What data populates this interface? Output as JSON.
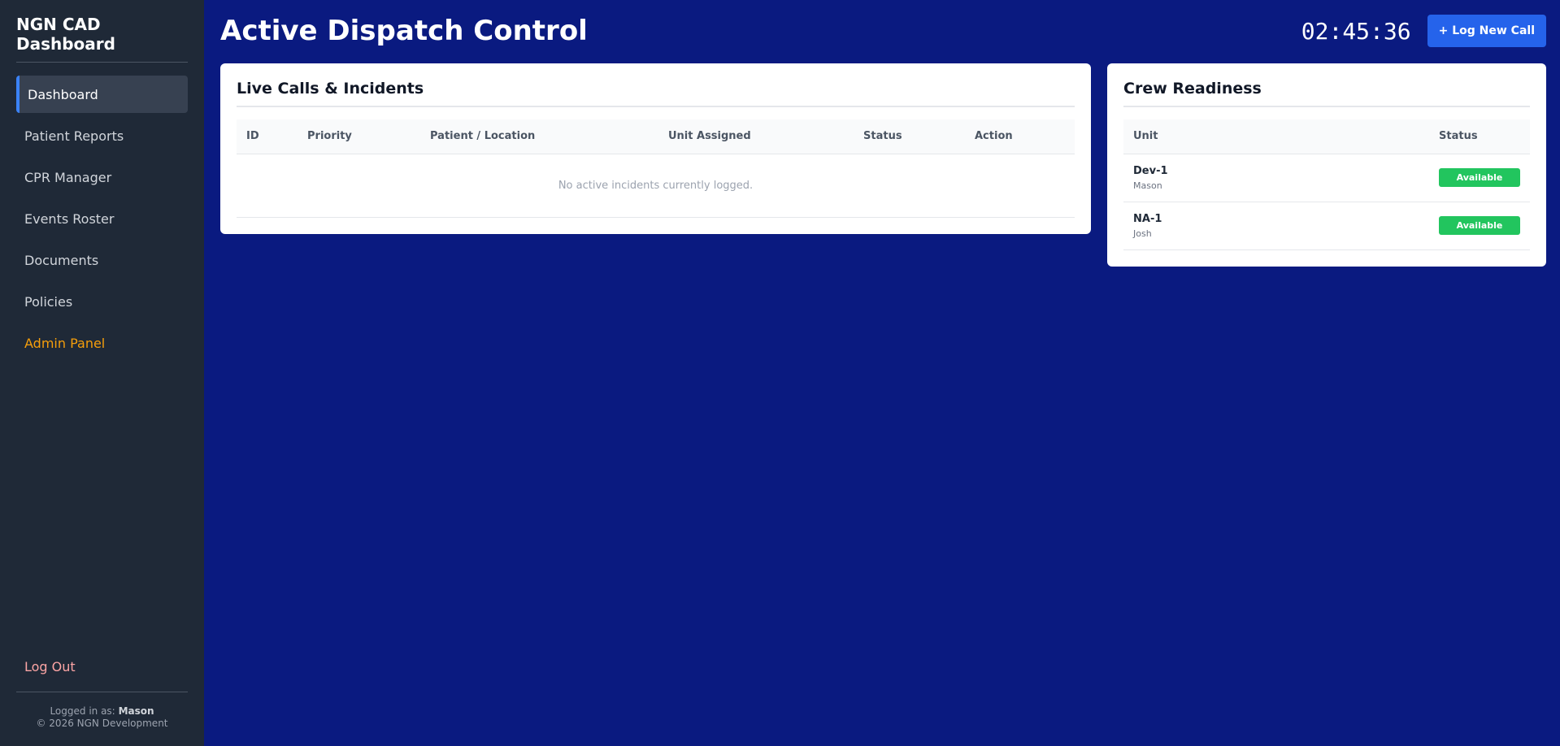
{
  "sidebar": {
    "brand": "NGN CAD Dashboard",
    "items": [
      {
        "label": "Dashboard"
      },
      {
        "label": "Patient Reports"
      },
      {
        "label": "CPR Manager"
      },
      {
        "label": "Events Roster"
      },
      {
        "label": "Documents"
      },
      {
        "label": "Policies"
      },
      {
        "label": "Admin Panel"
      }
    ],
    "logout": "Log Out",
    "footer": {
      "logged_in_prefix": "Logged in as:",
      "user": "Mason",
      "copyright": "© 2026 NGN Development"
    }
  },
  "header": {
    "title": "Active Dispatch Control",
    "clock": "02:45:36",
    "new_call_label": "+ Log New Call"
  },
  "live_calls": {
    "title": "Live Calls & Incidents",
    "columns": [
      "ID",
      "Priority",
      "Patient / Location",
      "Unit Assigned",
      "Status",
      "Action"
    ],
    "empty_text": "No active incidents currently logged."
  },
  "crew": {
    "title": "Crew Readiness",
    "columns": [
      "Unit",
      "Status"
    ],
    "rows": [
      {
        "unit": "Dev-1",
        "member": "Mason",
        "status": "Available"
      },
      {
        "unit": "NA-1",
        "member": "Josh",
        "status": "Available"
      }
    ]
  },
  "colors": {
    "background": "#0a1a80",
    "sidebar": "#1f2937",
    "accent": "#2563eb",
    "available": "#22c55e",
    "admin": "#f59e0b",
    "logout": "#fca5a5"
  }
}
